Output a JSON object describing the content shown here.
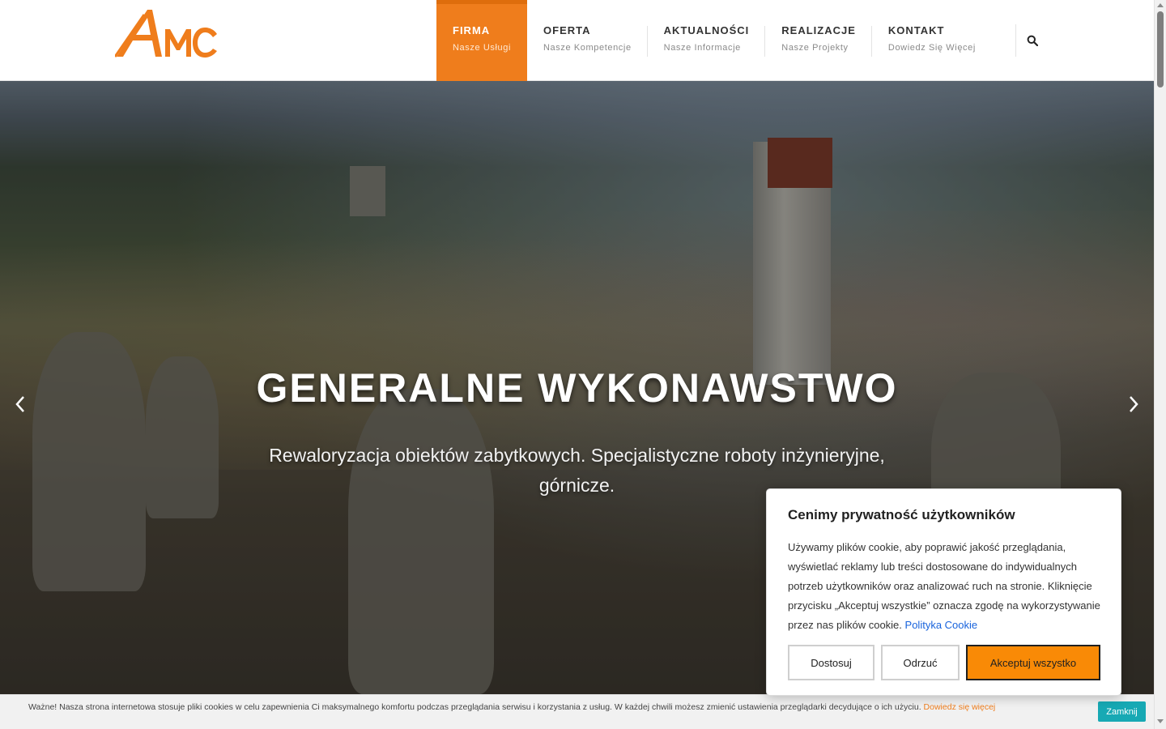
{
  "brand": {
    "logo_text": "AMC",
    "accent_color": "#ef7d1c"
  },
  "nav": {
    "items": [
      {
        "title": "FIRMA",
        "subtitle": "Nasze Usługi",
        "active": true
      },
      {
        "title": "OFERTA",
        "subtitle": "Nasze Kompetencje"
      },
      {
        "title": "AKTUALNOŚCI",
        "subtitle": "Nasze Informacje"
      },
      {
        "title": "REALIZACJE",
        "subtitle": "Nasze Projekty"
      },
      {
        "title": "KONTAKT",
        "subtitle": "Dowiedz Się Więcej"
      }
    ],
    "search_icon": "search-icon"
  },
  "hero": {
    "title": "GENERALNE WYKONAWSTWO",
    "subtitle": "Rewaloryzacja obiektów zabytkowych. Specjalistyczne roboty inżynieryjne, górnicze.",
    "prev_icon": "chevron-left-icon",
    "next_icon": "chevron-right-icon"
  },
  "privacy_modal": {
    "title": "Cenimy prywatność użytkowników",
    "body": "Używamy plików cookie, aby poprawić jakość przeglądania, wyświetlać reklamy lub treści dostosowane do indywidualnych potrzeb użytkowników oraz analizować ruch na stronie. Kliknięcie przycisku „Akceptuj wszystkie” oznacza zgodę na wykorzystywanie przez nas plików cookie.",
    "link_label": "Polityka Cookie",
    "buttons": {
      "customize": "Dostosuj",
      "reject": "Odrzuć",
      "accept": "Akceptuj wszystko"
    },
    "accept_color": "#f98a06"
  },
  "cookie_bar": {
    "text": "Ważne! Nasza strona internetowa stosuje pliki cookies w celu zapewnienia Ci maksymalnego komfortu podczas przeglądania serwisu i korzystania z usług. W każdej chwili możesz zmienić ustawienia przeglądarki decydujące o ich użyciu.",
    "link_label": "Dowiedz się więcej",
    "close_label": "Zamknij",
    "close_color": "#17a9b4"
  }
}
